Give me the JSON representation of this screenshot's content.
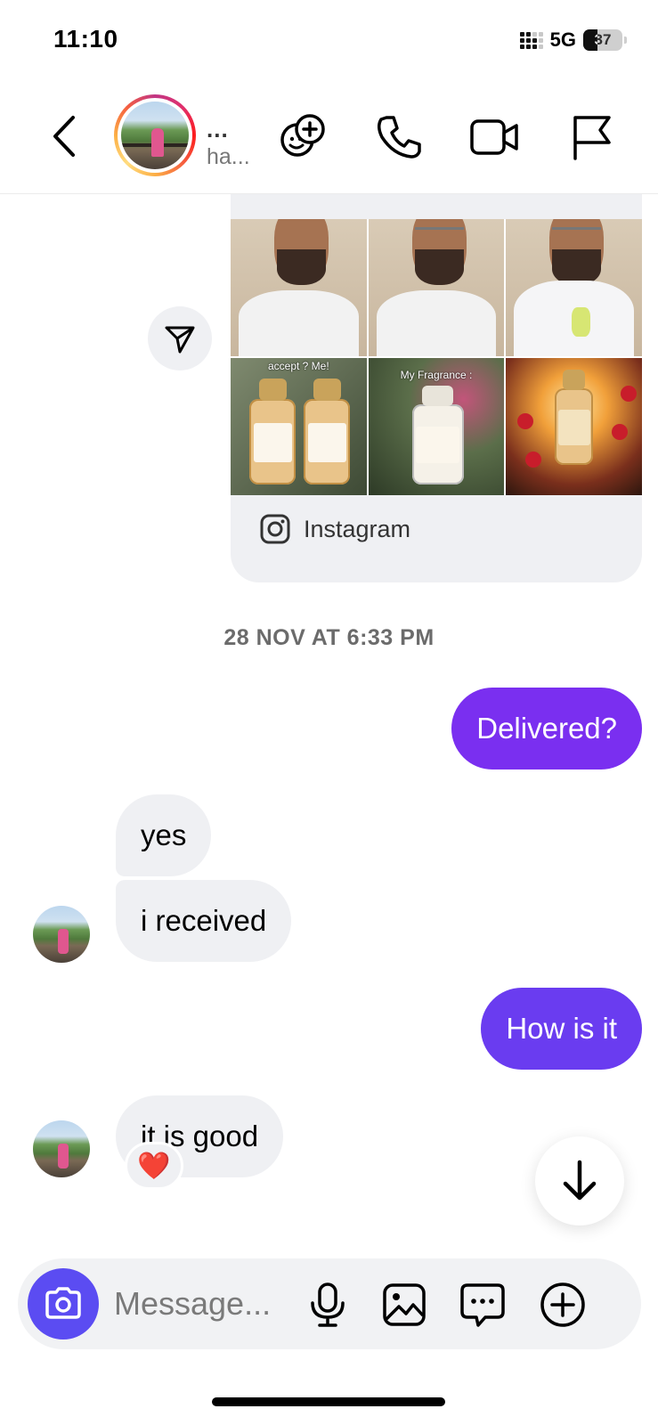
{
  "status_bar": {
    "time": "11:10",
    "network": "5G",
    "battery": "37",
    "battery_level": 0.37
  },
  "header": {
    "name": "...",
    "subtitle": "ha...",
    "icons": [
      "back-icon",
      "avatar",
      "effects-icon",
      "phone-icon",
      "video-call-icon",
      "flag-icon"
    ]
  },
  "shared_post": {
    "overlay_texts": [
      "accept ? Me!",
      "My Fragrance :"
    ],
    "source_label": "Instagram",
    "share_icon": "send-icon"
  },
  "timestamp": "28 NOV AT 6:33 PM",
  "messages": [
    {
      "from": "me",
      "text": "Delivered?",
      "color": "#7a2ff0"
    },
    {
      "from": "them",
      "text": "yes"
    },
    {
      "from": "them",
      "text": "i received"
    },
    {
      "from": "me",
      "text": "How is it",
      "color": "#6a3cf0"
    },
    {
      "from": "them",
      "text": "it is good",
      "reaction": "❤️"
    }
  ],
  "composer": {
    "placeholder": "Message...",
    "camera_color": "#5b4cf2",
    "icons": [
      "camera-icon",
      "microphone-icon",
      "gallery-icon",
      "sticker-chat-icon",
      "add-icon"
    ]
  },
  "colors": {
    "outgoing_1": "#7a2ff0",
    "outgoing_2": "#6a3cf0",
    "incoming": "#eff0f3",
    "camera": "#5b4cf2"
  }
}
